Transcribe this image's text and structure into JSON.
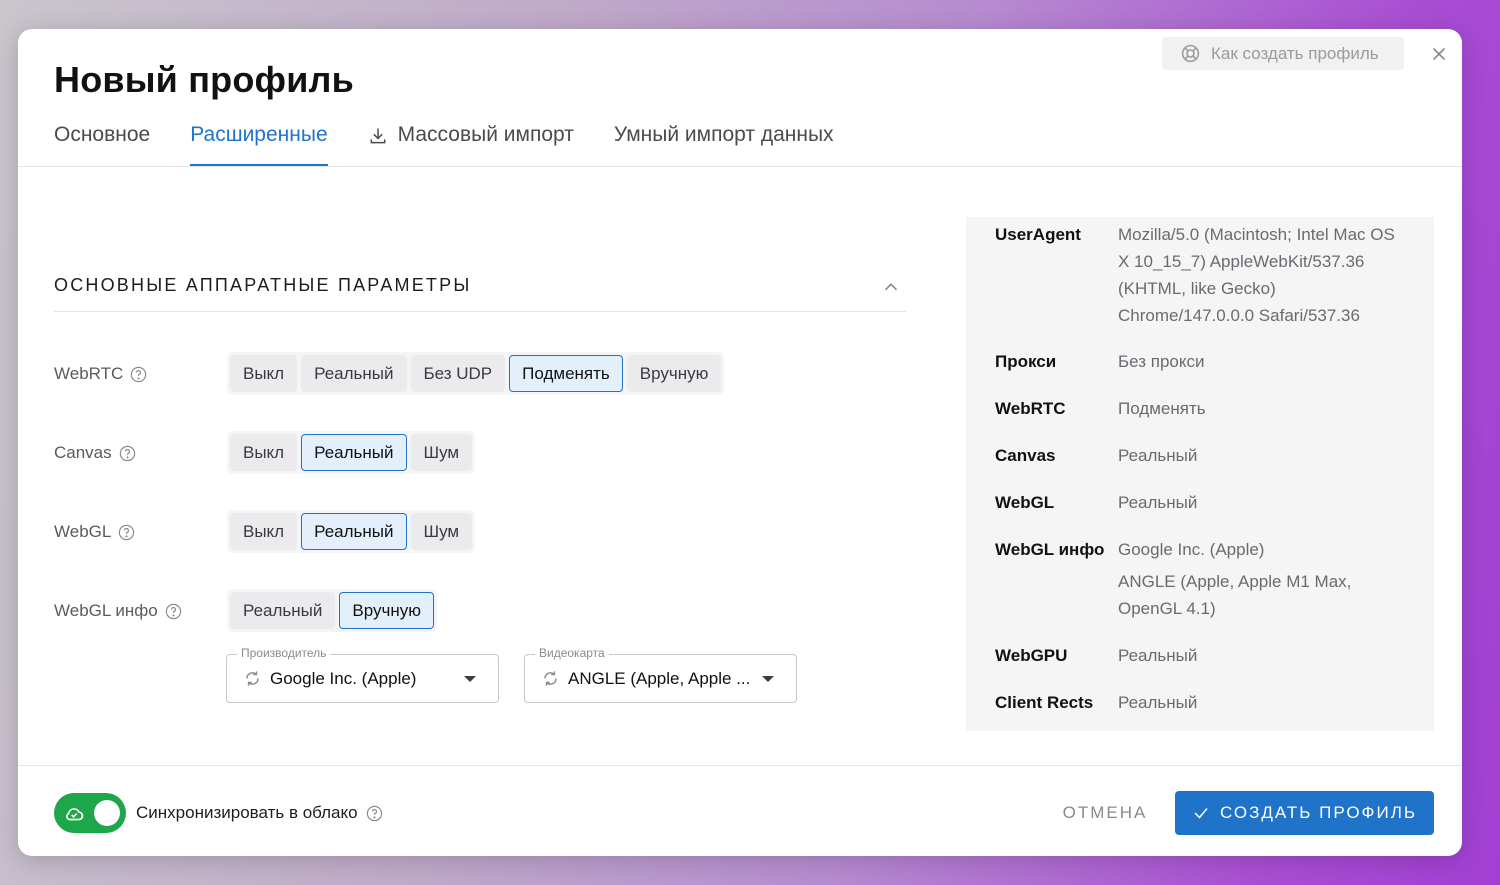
{
  "dialog": {
    "title": "Новый профиль",
    "help_button": "Как создать профиль",
    "close_icon": "close-icon"
  },
  "tabs": [
    {
      "label": "Основное",
      "active": false
    },
    {
      "label": "Расширенные",
      "active": true
    },
    {
      "label": "Массовый импорт",
      "icon": "download-icon",
      "active": false
    },
    {
      "label": "Умный импорт данных",
      "active": false
    }
  ],
  "section": {
    "title": "ОСНОВНЫЕ АППАРАТНЫЕ ПАРАМЕТРЫ",
    "collapse_icon": "chevron-up-icon"
  },
  "settings": {
    "webrtc": {
      "label": "WebRTC",
      "options": [
        "Выкл",
        "Реальный",
        "Без UDP",
        "Подменять",
        "Вручную"
      ],
      "selected": "Подменять"
    },
    "canvas": {
      "label": "Canvas",
      "options": [
        "Выкл",
        "Реальный",
        "Шум"
      ],
      "selected": "Реальный"
    },
    "webgl": {
      "label": "WebGL",
      "options": [
        "Выкл",
        "Реальный",
        "Шум"
      ],
      "selected": "Реальный"
    },
    "webgl_info": {
      "label": "WebGL инфо",
      "options": [
        "Реальный",
        "Вручную"
      ],
      "selected": "Вручную"
    },
    "vendor_select": {
      "label": "Производитель",
      "value": "Google Inc. (Apple)"
    },
    "gpu_select": {
      "label": "Видеокарта",
      "value": "ANGLE (Apple, Apple ..."
    }
  },
  "summary": {
    "useragent": {
      "key": "UserAgent",
      "value": "Mozilla/5.0 (Macintosh; Intel Mac OS X 10_15_7) AppleWebKit/537.36 (KHTML, like Gecko) Chrome/147.0.0.0 Safari/537.36"
    },
    "proxy": {
      "key": "Прокси",
      "value": "Без прокси"
    },
    "webrtc": {
      "key": "WebRTC",
      "value": "Подменять"
    },
    "canvas": {
      "key": "Canvas",
      "value": "Реальный"
    },
    "webgl": {
      "key": "WebGL",
      "value": "Реальный"
    },
    "webgl_info": {
      "key": "WebGL инфо",
      "value1": "Google Inc. (Apple)",
      "value2": "ANGLE (Apple, Apple M1 Max, OpenGL 4.1)"
    },
    "webgpu": {
      "key": "WebGPU",
      "value": "Реальный"
    },
    "client_rects": {
      "key": "Client Rects",
      "value": "Реальный"
    }
  },
  "footer": {
    "sync_label": "Синхронизировать в облако",
    "sync_on": true,
    "cancel": "ОТМЕНА",
    "create": "СОЗДАТЬ ПРОФИЛЬ"
  },
  "colors": {
    "accent": "#1f73c9",
    "toggle_on": "#1ea64a"
  }
}
